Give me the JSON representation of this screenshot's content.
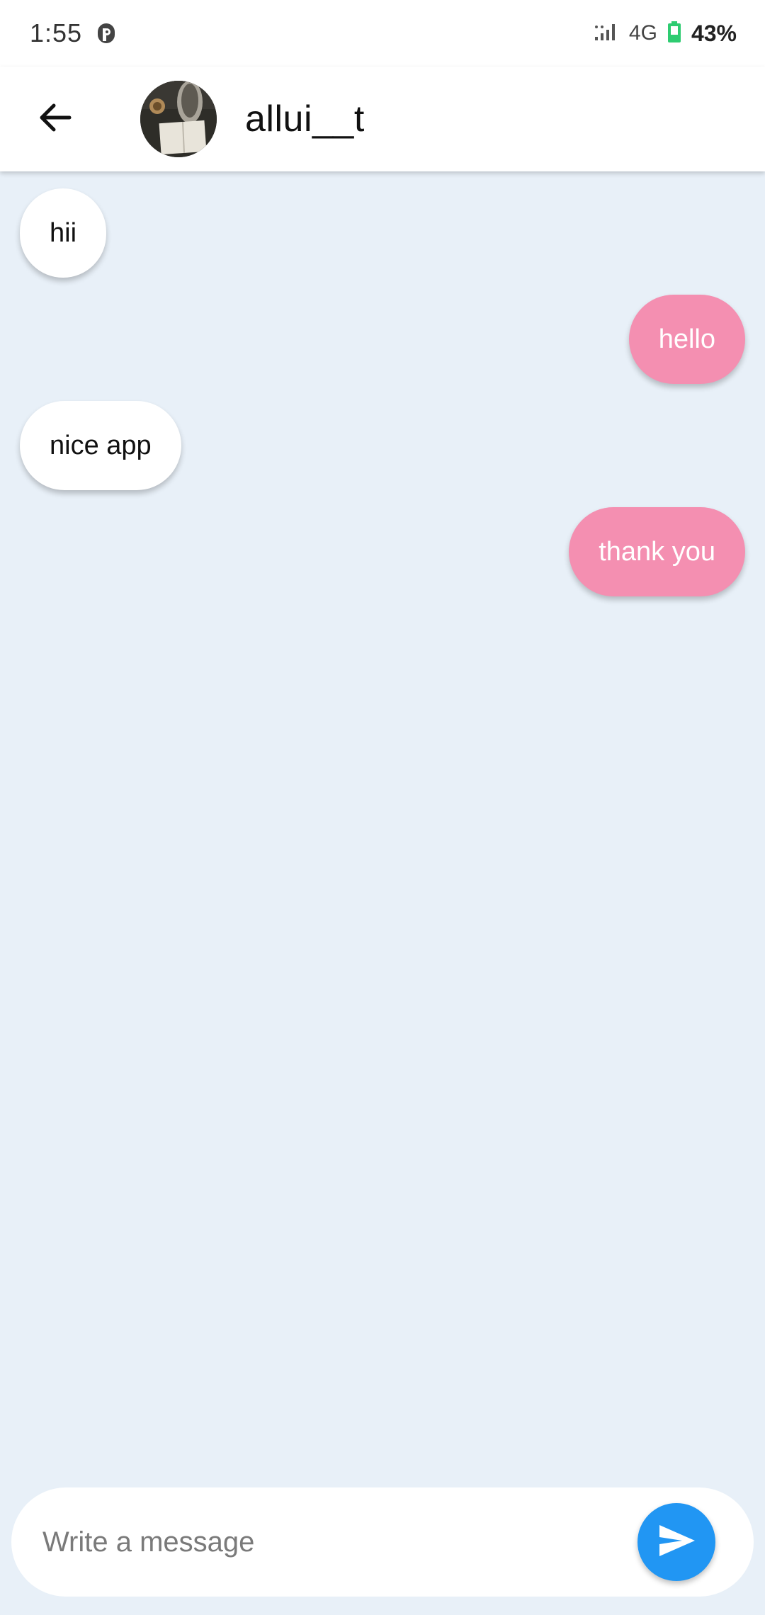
{
  "status_bar": {
    "time": "1:55",
    "network": "4G",
    "battery": "43%",
    "icons": [
      "parking-icon",
      "signal-icon",
      "battery-icon"
    ]
  },
  "header": {
    "contact_name": "allui__t",
    "icons": [
      "back-arrow-icon"
    ]
  },
  "messages": [
    {
      "side": "incoming",
      "text": "hii"
    },
    {
      "side": "outgoing",
      "text": "hello"
    },
    {
      "side": "incoming",
      "text": "nice app"
    },
    {
      "side": "outgoing",
      "text": "thank you"
    }
  ],
  "composer": {
    "placeholder": "Write a message",
    "send_icon": "send-icon"
  },
  "colors": {
    "background": "#e8f0f8",
    "incoming_bubble": "#ffffff",
    "outgoing_bubble": "#f48fb1",
    "send_button": "#2196f3",
    "battery": "#2ecc71"
  }
}
